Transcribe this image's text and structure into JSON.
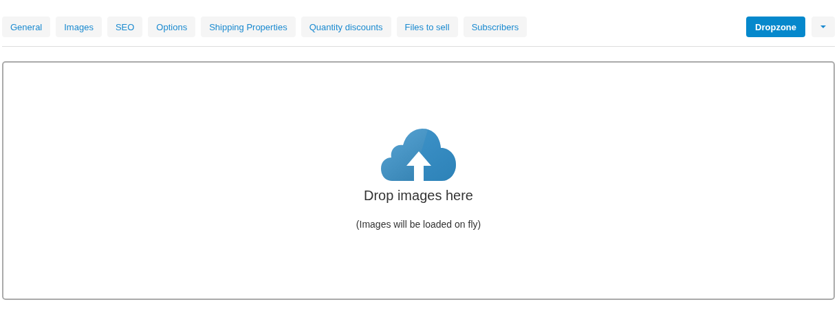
{
  "tabs": [
    {
      "label": "General",
      "selected": false
    },
    {
      "label": "Images",
      "selected": false
    },
    {
      "label": "SEO",
      "selected": false
    },
    {
      "label": "Options",
      "selected": false
    },
    {
      "label": "Shipping Properties",
      "selected": false
    },
    {
      "label": "Quantity discounts",
      "selected": false
    },
    {
      "label": "Files to sell",
      "selected": false
    },
    {
      "label": "Subscribers",
      "selected": false
    }
  ],
  "mode_button": {
    "label": "Dropzone",
    "active": true
  },
  "dropzone": {
    "title": "Drop images here",
    "hint": "(Images will be loaded on fly)"
  }
}
